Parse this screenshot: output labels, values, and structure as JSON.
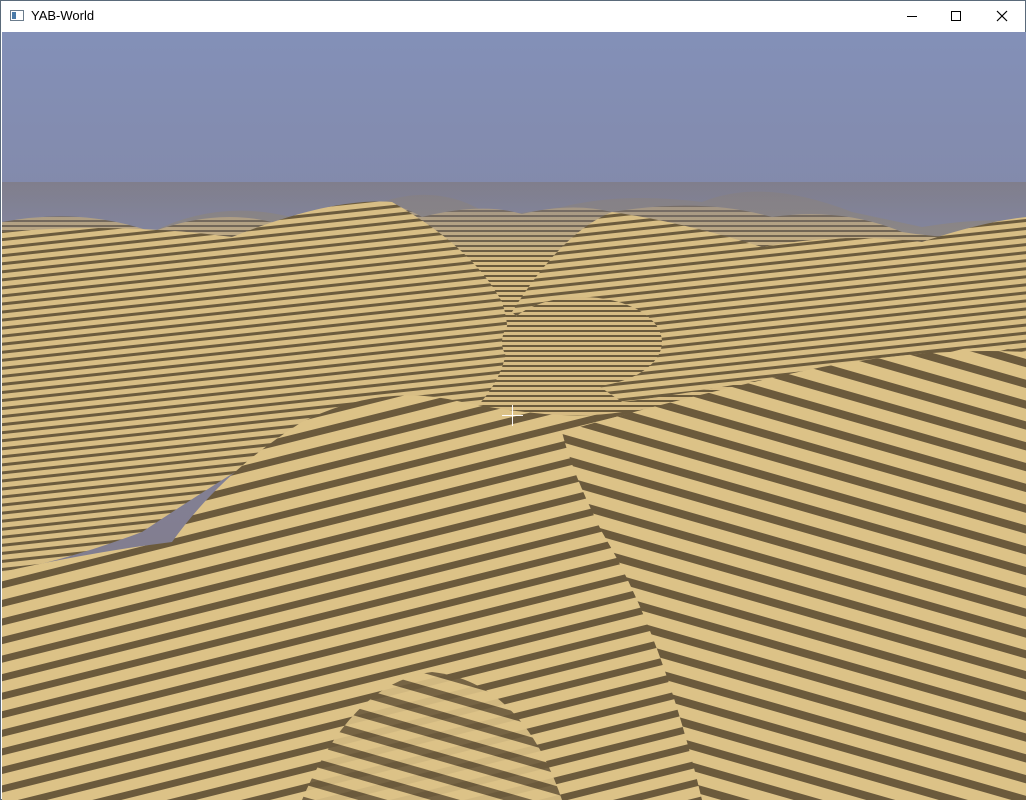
{
  "window": {
    "title": "YAB-World",
    "controls": {
      "minimize": "minimize-icon",
      "maximize": "maximize-icon",
      "close": "close-icon"
    }
  },
  "scene": {
    "sky_top": "#8390b8",
    "sky_horizon": "#7f7a82",
    "sand_light": "#dbc186",
    "sand_dark": "#6a5a3c",
    "crosshair": "crosshair-icon"
  }
}
